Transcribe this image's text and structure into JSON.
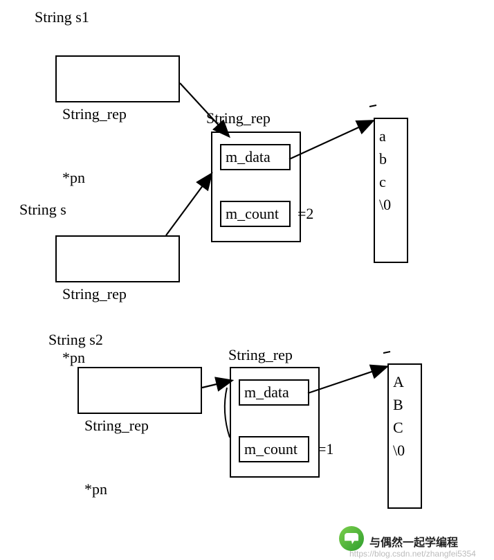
{
  "labels": {
    "s1": "String s1",
    "s": "String s",
    "s2": "String s2",
    "rep1": "String_rep",
    "rep2": "String_rep"
  },
  "ptr_box": {
    "line1": "String_rep",
    "line2": "*pn"
  },
  "rep": {
    "m_data": "m_data",
    "m_count": "m_count"
  },
  "top": {
    "count_eq": "=2",
    "data": "a\nb\nc\n\\0"
  },
  "bottom": {
    "count_eq": "=1",
    "data": "A\nB\nC\n\\0"
  },
  "watermark": {
    "text": "与偶然一起学编程",
    "sub": "https://blog.csdn.net/zhangfei5354"
  }
}
